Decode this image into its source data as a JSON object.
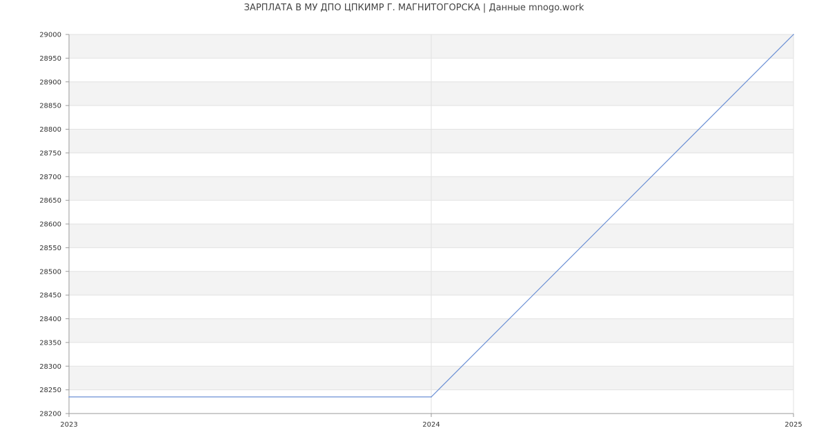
{
  "chart_data": {
    "type": "line",
    "title": "ЗАРПЛАТА В МУ ДПО ЦПКИМР Г. МАГНИТОГОРСКА | Данные mnogo.work",
    "x": [
      "2023",
      "2024",
      "2025"
    ],
    "series": [
      {
        "values": [
          28235,
          28235,
          29000
        ]
      }
    ],
    "ylim": [
      28200,
      29000
    ],
    "y_ticks": [
      28200,
      28250,
      28300,
      28350,
      28400,
      28450,
      28500,
      28550,
      28600,
      28650,
      28700,
      28750,
      28800,
      28850,
      28900,
      28950,
      29000
    ],
    "grid": true,
    "legend": "none",
    "colors": {
      "line": "#6a8fd4",
      "band": "#f3f3f3",
      "grid": "#e2e2e2",
      "axis": "#999999"
    }
  }
}
